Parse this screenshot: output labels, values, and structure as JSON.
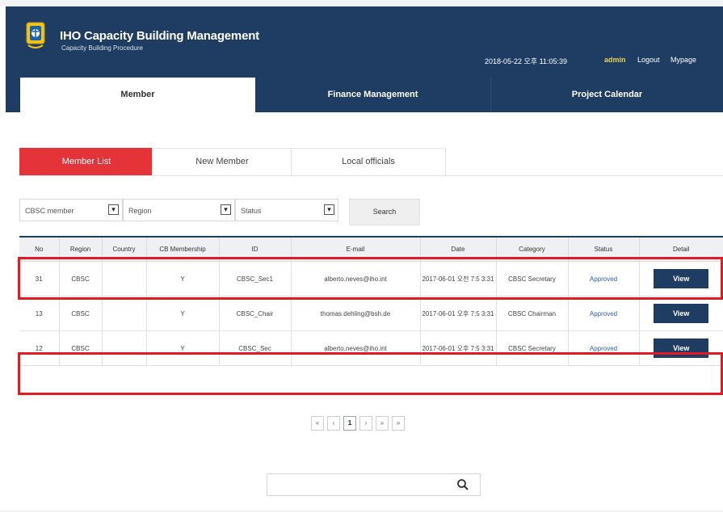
{
  "header": {
    "title": "IHO Capacity Building Management",
    "subtitle": "Capacity Building Procedure",
    "datetime": "2018-05-22 오후 11:05:39",
    "user": "admin",
    "logout": "Logout",
    "mypage": "Mypage"
  },
  "nav": [
    "Member",
    "Finance Management",
    "Project Calendar"
  ],
  "subtabs": [
    "Member List",
    "New Member",
    "Local officials"
  ],
  "filters": {
    "member": "CBSC member",
    "region": "Region",
    "status": "Status",
    "search_label": "Search"
  },
  "table": {
    "columns": [
      "No",
      "Region",
      "Country",
      "CB Membership",
      "ID",
      "E-mail",
      "Date",
      "Category",
      "Status",
      "Detail"
    ],
    "rows": [
      {
        "no": "31",
        "region": "CBSC",
        "country": "",
        "membership": "Y",
        "id": "CBSC_Sec1",
        "email": "alberto.neves@iho.int",
        "date": "2017-06-01 오전 7:5 3:31",
        "category": "CBSC Secretary",
        "status": "Approved",
        "detail": "View"
      },
      {
        "no": "13",
        "region": "CBSC",
        "country": "",
        "membership": "Y",
        "id": "CBSC_Chair",
        "email": "thomas.dehling@bsh.de",
        "date": "2017-06-01 오후 7:5 3:31",
        "category": "CBSC Chairman",
        "status": "Approved",
        "detail": "View"
      },
      {
        "no": "12",
        "region": "CBSC",
        "country": "",
        "membership": "Y",
        "id": "CBSC_Sec",
        "email": "alberto.neves@iho.int",
        "date": "2017-06-01 오후 7:5 3:31",
        "category": "CBSC Secretary",
        "status": "Approved",
        "detail": "View"
      }
    ]
  },
  "pagination": {
    "first": "«",
    "prev": "‹",
    "current": "1",
    "next": "›",
    "last": "»",
    "more": "»"
  },
  "bottom_search": {
    "placeholder": "",
    "icon": "search-icon"
  },
  "colors": {
    "navy": "#1f3d63",
    "accent_red": "#e5333a",
    "highlight": "#e01b24",
    "link": "#2f5ea8"
  }
}
